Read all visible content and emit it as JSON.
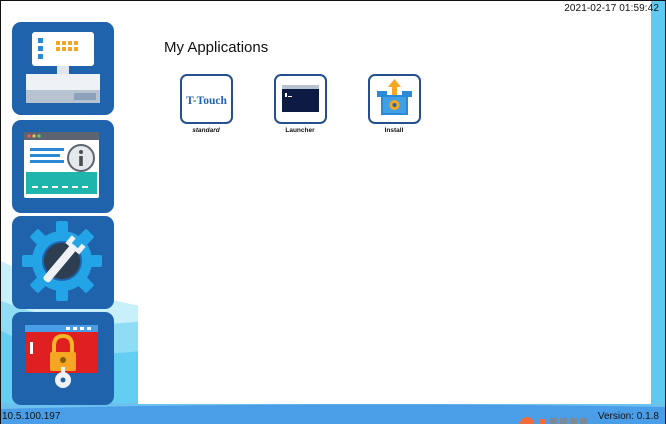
{
  "clock": "2021-02-17 01:59:42",
  "panel": {
    "title": "My Applications"
  },
  "apps": [
    {
      "label": "standard",
      "icon_text": "T-Touch",
      "icon": "t-touch-icon"
    },
    {
      "label": "Launcher",
      "icon": "terminal-window-icon"
    },
    {
      "label": "Install",
      "icon": "package-box-icon"
    }
  ],
  "sidebar": {
    "items": [
      {
        "icon": "pos-terminal-icon"
      },
      {
        "icon": "system-info-icon"
      },
      {
        "icon": "settings-wrench-icon"
      },
      {
        "icon": "lock-key-icon"
      }
    ]
  },
  "footer": {
    "ip": "10.5.100.197",
    "version": "Version: 0.1.8"
  },
  "colors": {
    "tile_blue": "#1f63ad",
    "sky_light": "#c8f0fb",
    "sky_mid": "#7cd7f5",
    "sky_deep": "#4a9ee8",
    "icon_border": "#24508f",
    "lock_red": "#e02020"
  }
}
